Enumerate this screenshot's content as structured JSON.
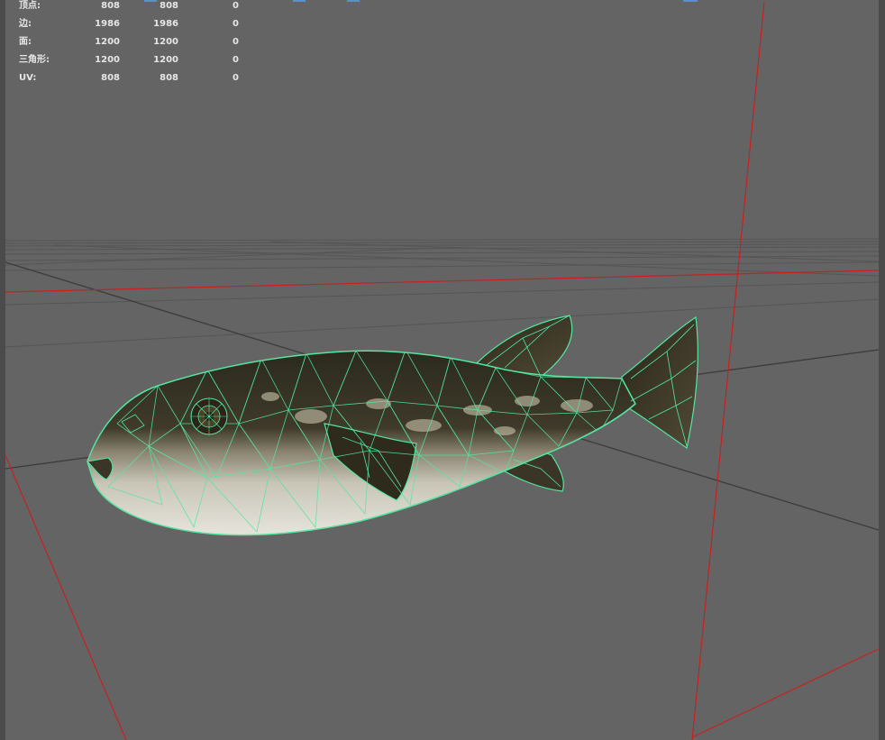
{
  "viewport": {
    "background": "#646464",
    "grid_color": "#555555",
    "axis_color": "#3c3c3c",
    "camera_line_color": "#c82020",
    "wireframe_color": "#55e6a0"
  },
  "hud": {
    "rows": [
      {
        "label": "顶点:",
        "col1": "808",
        "col2": "808",
        "col3": "0"
      },
      {
        "label": "边:",
        "col1": "1986",
        "col2": "1986",
        "col3": "0"
      },
      {
        "label": "面:",
        "col1": "1200",
        "col2": "1200",
        "col3": "0"
      },
      {
        "label": "三角形:",
        "col1": "1200",
        "col2": "1200",
        "col3": "0"
      },
      {
        "label": "UV:",
        "col1": "808",
        "col2": "808",
        "col3": "0"
      }
    ]
  },
  "model": {
    "icon": "pufferfish-mesh"
  }
}
